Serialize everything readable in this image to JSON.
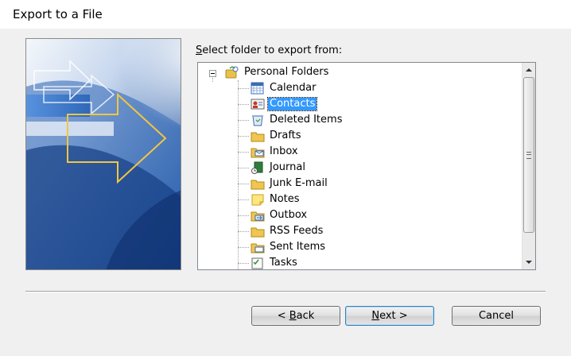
{
  "window": {
    "title": "Export to a File"
  },
  "prompt": {
    "accel": "S",
    "rest": "elect folder to export from:"
  },
  "tree": {
    "root": {
      "label": "Personal Folders",
      "icon": "personal-folders-icon"
    },
    "items": [
      {
        "label": "Calendar",
        "icon": "calendar-icon",
        "selected": false
      },
      {
        "label": "Contacts",
        "icon": "contacts-icon",
        "selected": true
      },
      {
        "label": "Deleted Items",
        "icon": "deleted-items-icon",
        "selected": false
      },
      {
        "label": "Drafts",
        "icon": "drafts-folder-icon",
        "selected": false
      },
      {
        "label": "Inbox",
        "icon": "inbox-icon",
        "selected": false
      },
      {
        "label": "Journal",
        "icon": "journal-icon",
        "selected": false
      },
      {
        "label": "Junk E-mail",
        "icon": "junk-email-icon",
        "selected": false
      },
      {
        "label": "Notes",
        "icon": "notes-icon",
        "selected": false
      },
      {
        "label": "Outbox",
        "icon": "outbox-icon",
        "selected": false
      },
      {
        "label": "RSS Feeds",
        "icon": "rss-feeds-folder-icon",
        "selected": false
      },
      {
        "label": "Sent Items",
        "icon": "sent-items-icon",
        "selected": false
      },
      {
        "label": "Tasks",
        "icon": "tasks-icon",
        "selected": false
      }
    ]
  },
  "buttons": {
    "back": {
      "prefix": "< ",
      "accel": "B",
      "rest": "ack"
    },
    "next": {
      "accel": "N",
      "rest": "ext >"
    },
    "cancel": {
      "label": "Cancel"
    }
  },
  "colors": {
    "selection": "#3399ff",
    "banner_blue": "#2f6fc0",
    "arrow_yellow": "#f2c641"
  }
}
